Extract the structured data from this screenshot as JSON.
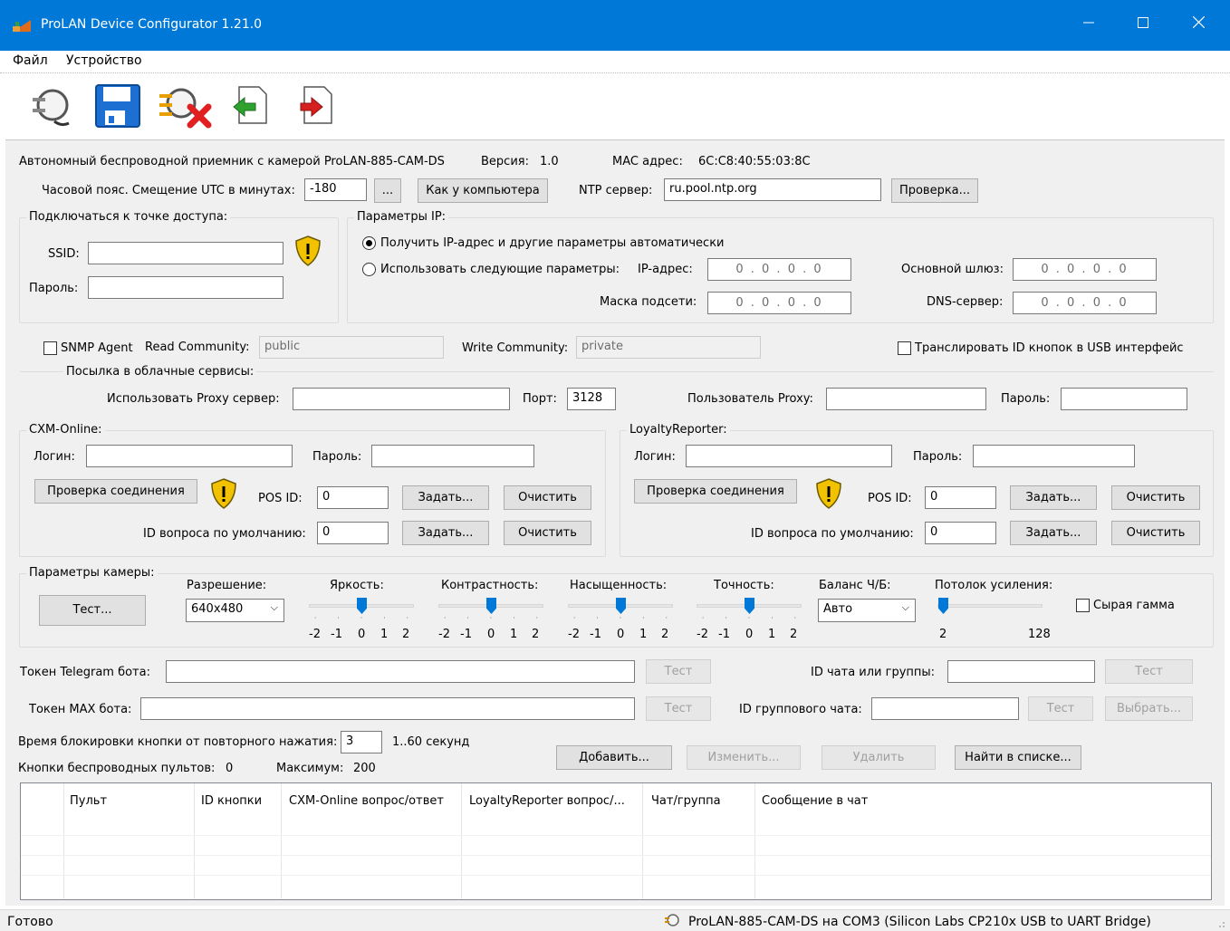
{
  "window": {
    "title": "ProLAN Device Configurator 1.21.0",
    "minimize_icon": "minimize-icon",
    "maximize_icon": "maximize-icon",
    "close_icon": "close-icon",
    "accent": "#0078d7"
  },
  "menu": {
    "file": "Файл",
    "device": "Устройство"
  },
  "toolbar": {
    "icons": [
      "connect-plug-icon",
      "save-floppy-icon",
      "disconnect-icon",
      "import-icon",
      "export-icon"
    ]
  },
  "device": {
    "name": "Автономный беспроводной приемник с камерой ProLAN-885-CAM-DS",
    "version_label": "Версия:",
    "version_value": "1.0",
    "mac_label": "MAC адрес:",
    "mac_value": "6C:C8:40:55:03:8C"
  },
  "timezone": {
    "label": "Часовой пояс. Смещение UTC в минутах:",
    "value": "-180",
    "dots_button": "...",
    "like_computer_button": "Как у компьютера",
    "ntp_label": "NTP сервер:",
    "ntp_value": "ru.pool.ntp.org",
    "check_button": "Проверка..."
  },
  "ap": {
    "title": "Подключаться к точке доступа:",
    "ssid_label": "SSID:",
    "ssid_value": "",
    "password_label": "Пароль:",
    "password_value": ""
  },
  "ip": {
    "title": "Параметры IP:",
    "auto_label": "Получить IP-адрес и другие параметры автоматически",
    "manual_label": "Использовать следующие параметры:",
    "ip_label": "IP-адрес:",
    "ip_value": "0 . 0 . 0 . 0",
    "gateway_label": "Основной шлюз:",
    "gateway_value": "0 . 0 . 0 . 0",
    "mask_label": "Маска подсети:",
    "mask_value": "0 . 0 . 0 . 0",
    "dns_label": "DNS-сервер:",
    "dns_value": "0 . 0 . 0 . 0"
  },
  "snmp": {
    "agent_label": "SNMP Agent",
    "read_label": "Read Community:",
    "read_value": "public",
    "write_label": "Write Community:",
    "write_value": "private",
    "usb_label": "Транслировать ID кнопок в USB интерфейс"
  },
  "cloud": {
    "title": "Посылка в облачные сервисы:",
    "proxy_label": "Использовать Proxy сервер:",
    "proxy_value": "",
    "port_label": "Порт:",
    "port_value": "3128",
    "proxy_user_label": "Пользователь Proxy:",
    "proxy_user_value": "",
    "proxy_password_label": "Пароль:",
    "proxy_password_value": ""
  },
  "cxm": {
    "title": "CXM-Online:",
    "login_label": "Логин:",
    "login_value": "",
    "password_label": "Пароль:",
    "password_value": "",
    "check_button": "Проверка соединения",
    "pos_label": "POS ID:",
    "pos_value": "0",
    "set_button": "Задать...",
    "clear_button": "Очистить",
    "question_label": "ID вопроса по умолчанию:",
    "question_value": "0"
  },
  "loyalty": {
    "title": "LoyaltyReporter:",
    "login_label": "Логин:",
    "login_value": "",
    "password_label": "Пароль:",
    "password_value": "",
    "check_button": "Проверка соединения",
    "pos_label": "POS ID:",
    "pos_value": "0",
    "set_button": "Задать...",
    "clear_button": "Очистить",
    "question_label": "ID вопроса по умолчанию:",
    "question_value": "0"
  },
  "camera": {
    "title": "Параметры камеры:",
    "test_button": "Тест...",
    "resolution_label": "Разрешение:",
    "resolution_value": "640x480",
    "brightness_label": "Яркость:",
    "contrast_label": "Контрастность:",
    "saturation_label": "Насыщенность:",
    "sharpness_label": "Точность:",
    "scale_labels": [
      "-2",
      "-1",
      "0",
      "1",
      "2"
    ],
    "brightness_value": 0,
    "contrast_value": 0,
    "saturation_value": 0,
    "sharpness_value": 0,
    "wb_label": "Баланс Ч/Б:",
    "wb_value": "Авто",
    "gain_label": "Потолок усиления:",
    "gain_min": "2",
    "gain_max": "128",
    "gain_value": 2,
    "raw_gamma_label": "Сырая гамма"
  },
  "telegram": {
    "token_label": "Токен Telegram бота:",
    "token_value": "",
    "test_button": "Тест",
    "chat_label": "ID чата или группы:",
    "chat_value": "",
    "chat_test_button": "Тест"
  },
  "max": {
    "token_label": "Токен MAX бота:",
    "token_value": "",
    "test_button": "Тест",
    "group_label": "ID группового чата:",
    "group_value": "",
    "group_test_button": "Тест",
    "select_button": "Выбрать..."
  },
  "buttons": {
    "block_label": "Время блокировки кнопки от повторного нажатия:",
    "block_value": "3",
    "block_range": "1..60 секунд",
    "remotes_label": "Кнопки беспроводных пультов:",
    "remotes_count": "0",
    "max_label": "Максимум:",
    "max_value": "200",
    "add_button": "Добавить...",
    "edit_button": "Изменить...",
    "delete_button": "Удалить",
    "find_button": "Найти в списке..."
  },
  "table": {
    "columns": [
      "Пульт",
      "ID кнопки",
      "CXM-Online вопрос/ответ",
      "LoyaltyReporter вопрос/...",
      "Чат/группа",
      "Сообщение в чат"
    ]
  },
  "status": {
    "left": "Готово",
    "right": "ProLAN-885-CAM-DS на COM3 (Silicon Labs CP210x USB to UART Bridge)"
  }
}
